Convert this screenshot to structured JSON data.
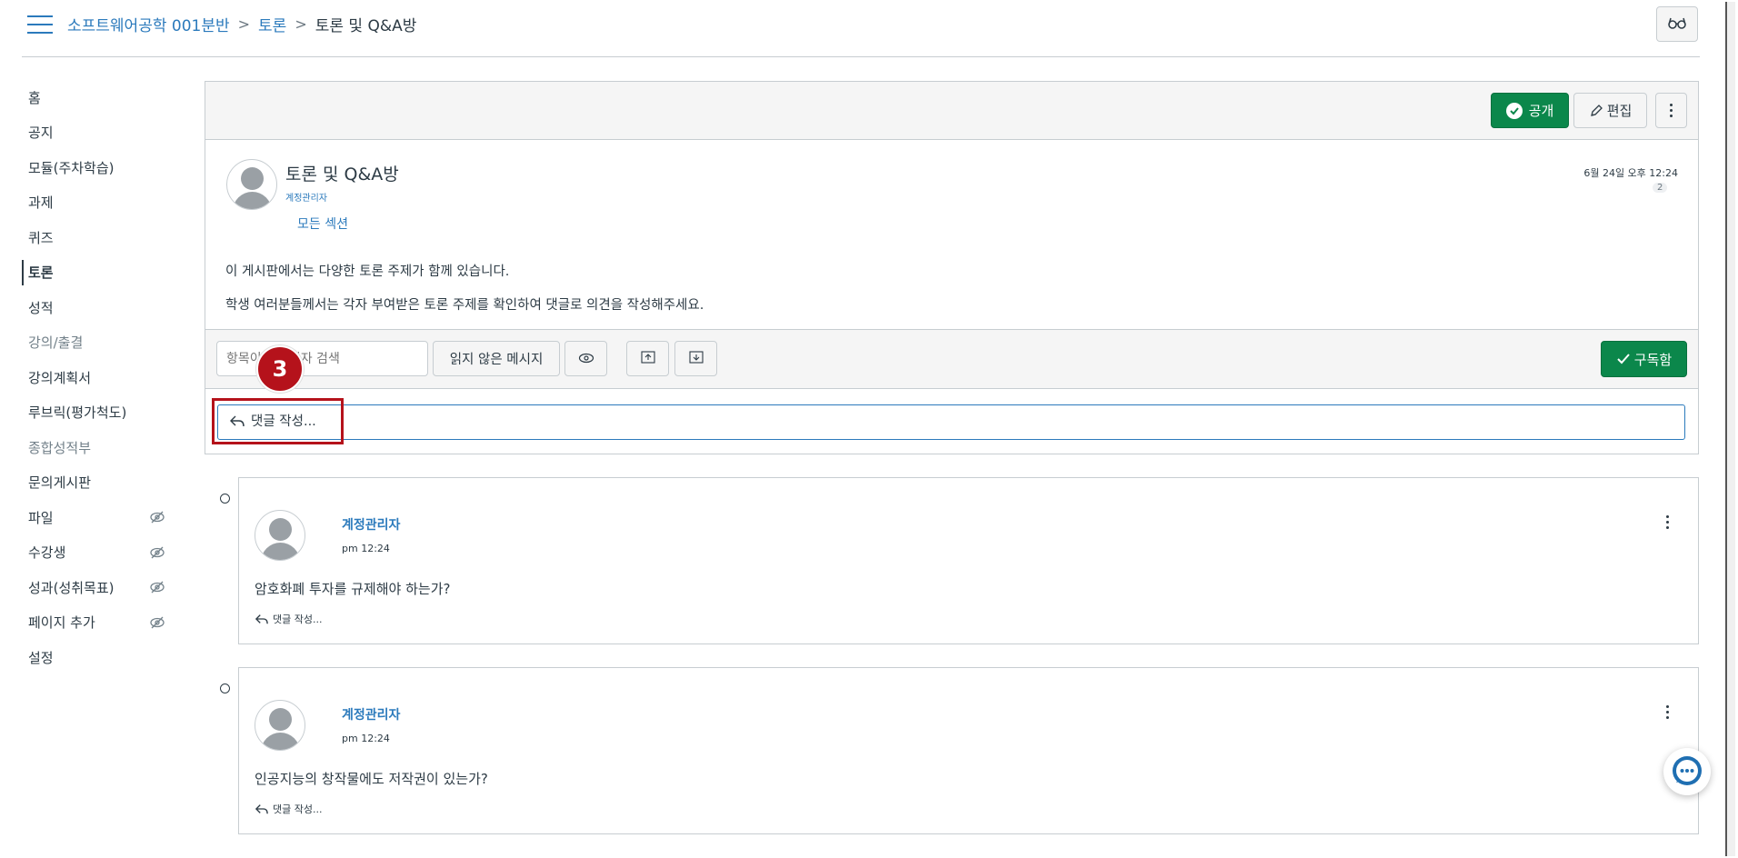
{
  "breadcrumb": {
    "course": "소프트웨어공학 001분반",
    "section": "토론",
    "current": "토론 및 Q&A방",
    "separator": ">"
  },
  "sidebar": {
    "items": [
      {
        "label": "홈"
      },
      {
        "label": "공지"
      },
      {
        "label": "모듈(주차학습)"
      },
      {
        "label": "과제"
      },
      {
        "label": "퀴즈"
      },
      {
        "label": "토론"
      },
      {
        "label": "성적"
      },
      {
        "label": "강의/출결"
      },
      {
        "label": "강의계획서"
      },
      {
        "label": "루브릭(평가척도)"
      },
      {
        "label": "종합성적부"
      },
      {
        "label": "문의게시판"
      },
      {
        "label": "파일"
      },
      {
        "label": "수강생"
      },
      {
        "label": "성과(성취목표)"
      },
      {
        "label": "페이지 추가"
      },
      {
        "label": "설정"
      }
    ],
    "active": "토론"
  },
  "toolbar": {
    "publish_label": "공개",
    "edit_label": "편집"
  },
  "topic": {
    "title": "토론 및 Q&A방",
    "author": "계정관리자",
    "sections": "모든 섹션",
    "date": "6월 24일 오후 12:24",
    "count": "2",
    "paragraph1": "이 게시판에서는 다양한 토론 주제가 함께 있습니다.",
    "paragraph2": "학생 여러분들께서는 각자 부여받은 토론 주제를 확인하여 댓글로 의견을 작성해주세요."
  },
  "filter": {
    "search_placeholder": "항목이나 작성자 검색",
    "unread_label": "읽지 않은 메시지",
    "subscribe_label": "구독함"
  },
  "reply": {
    "label": "댓글 작성..."
  },
  "annotation": {
    "step": "3",
    "color": "#b5121b"
  },
  "entries": [
    {
      "author": "계정관리자",
      "time": "pm 12:24",
      "text": "암호화폐 투자를 규제해야 하는가?",
      "reply_label": "댓글 작성..."
    },
    {
      "author": "계정관리자",
      "time": "pm 12:24",
      "text": "인공지능의 창작물에도 저작권이 있는가?",
      "reply_label": "댓글 작성..."
    }
  ],
  "colors": {
    "accent": "#2b7abc",
    "success": "#0b874b",
    "text": "#2d3b45"
  }
}
